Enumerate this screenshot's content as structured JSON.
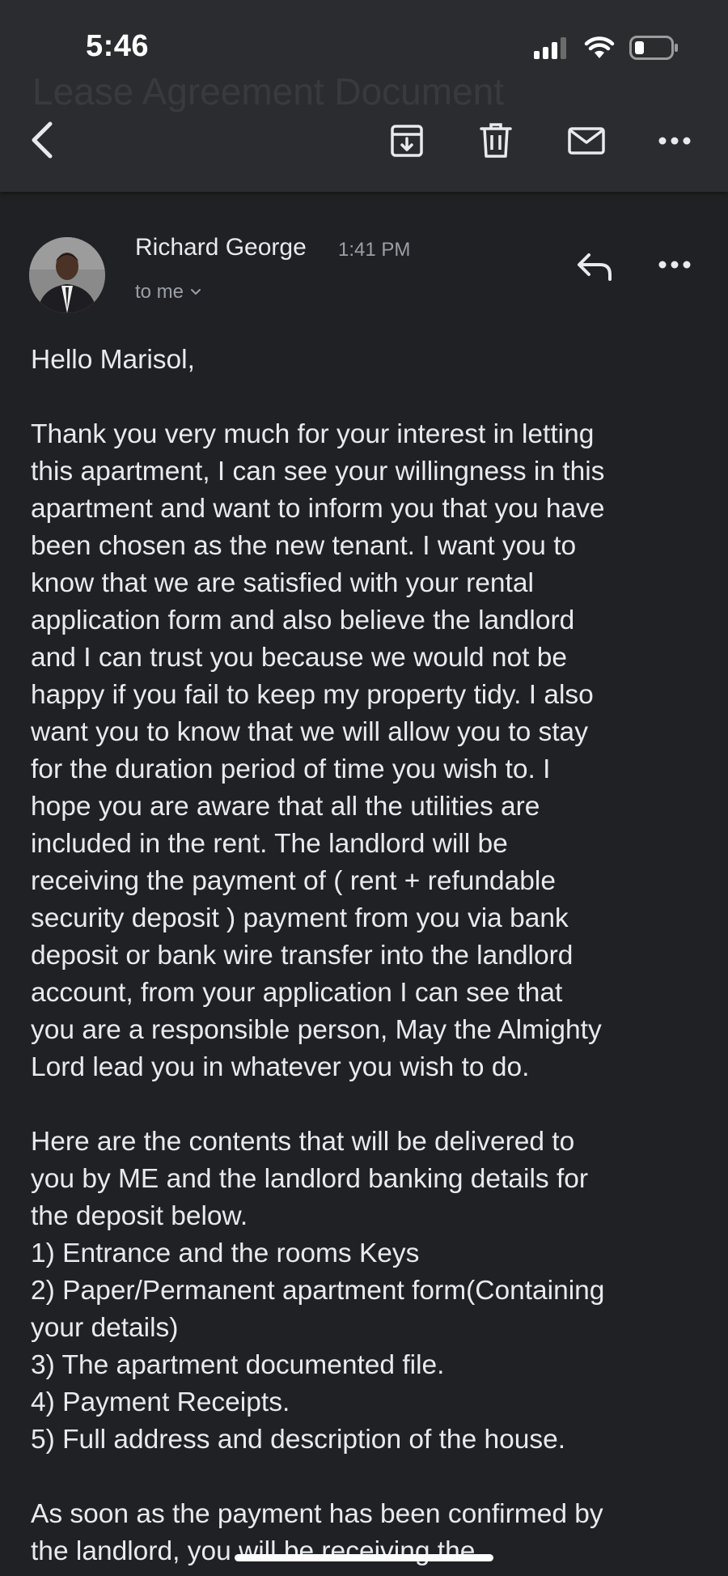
{
  "status_bar": {
    "time": "5:46",
    "icons": [
      "cellular-signal-icon",
      "wifi-icon",
      "battery-icon"
    ]
  },
  "header": {
    "ghost_title": "Lease Agreement Document",
    "icons": [
      "back-icon",
      "archive-icon",
      "delete-icon",
      "mark-unread-icon",
      "more-icon"
    ]
  },
  "message": {
    "sender_name": "Richard George",
    "time": "1:41 PM",
    "recipient": "to me",
    "greeting": "Hello Marisol,",
    "paragraph1": [
      "Thank you very much for your interest in letting",
      "this apartment, I can see your willingness in this",
      "apartment and want to inform you that you have",
      "been chosen as the new tenant. I want you to",
      "know that we are satisfied with your rental",
      "application form and also believe the landlord",
      "and I can trust you because we would not be",
      "happy if you fail to keep my property tidy. I also",
      "want you to know that we will allow you to stay",
      "for the duration period of time you wish to. I",
      "hope you are aware that all the utilities are",
      "included in the rent. The landlord will be",
      "receiving the payment of ( rent + refundable",
      "security deposit ) payment from you via bank",
      "deposit or bank wire transfer into the landlord",
      "account, from your application I can see that",
      "you are a responsible person, May the Almighty",
      "Lord lead you in whatever you wish to do."
    ],
    "paragraph2": [
      "Here are the contents that will be delivered to",
      "you by ME and the landlord banking details for",
      "the deposit below.",
      "1) Entrance and the rooms Keys",
      "2) Paper/Permanent apartment form(Containing",
      "your details)",
      "3) The apartment documented file.",
      "4) Payment Receipts.",
      "5) Full address and description of the house."
    ],
    "paragraph3": [
      "As soon as the payment has been confirmed by",
      "the landlord, you will be receiving the"
    ]
  },
  "colors": {
    "background": "#202124",
    "topbar": "#2b2c2f",
    "text": "#e8eaed",
    "muted": "#9aa0a6"
  }
}
